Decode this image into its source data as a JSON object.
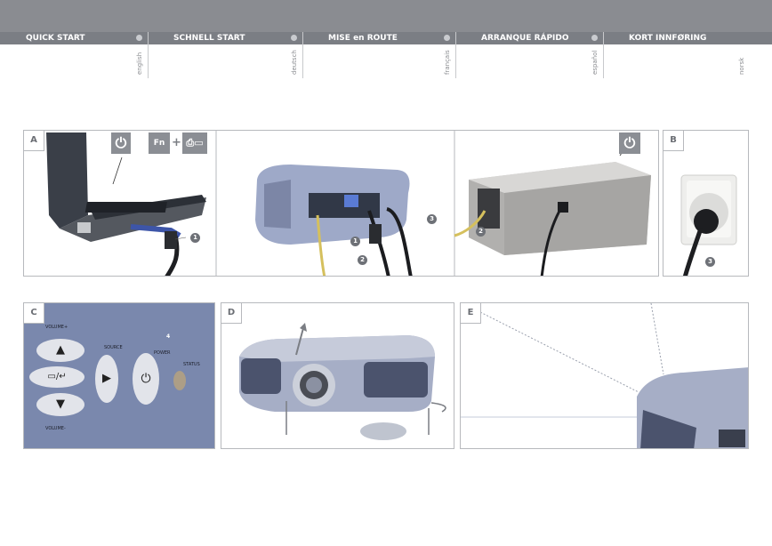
{
  "tabs": [
    {
      "title": "QUICK START",
      "lang": "english"
    },
    {
      "title": "SCHNELL START",
      "lang": "deutsch"
    },
    {
      "title": "MISE en ROUTE",
      "lang": "français"
    },
    {
      "title": "ARRANQUE RÁPIDO",
      "lang": "español"
    },
    {
      "title": "KORT INNFØRING",
      "lang": "norsk"
    }
  ],
  "panels": {
    "a": "A",
    "b": "B",
    "c": "C",
    "d": "D",
    "e": "E"
  },
  "keys": {
    "fn": "Fn",
    "plus": "+"
  },
  "callouts": {
    "one": "1",
    "two": "2",
    "three": "3",
    "four": "4"
  },
  "control_panel": {
    "volume_plus": "VOLUME+",
    "volume_minus": "VOLUME-",
    "source": "SOURCE",
    "power": "POWER",
    "status": "STATUS"
  }
}
